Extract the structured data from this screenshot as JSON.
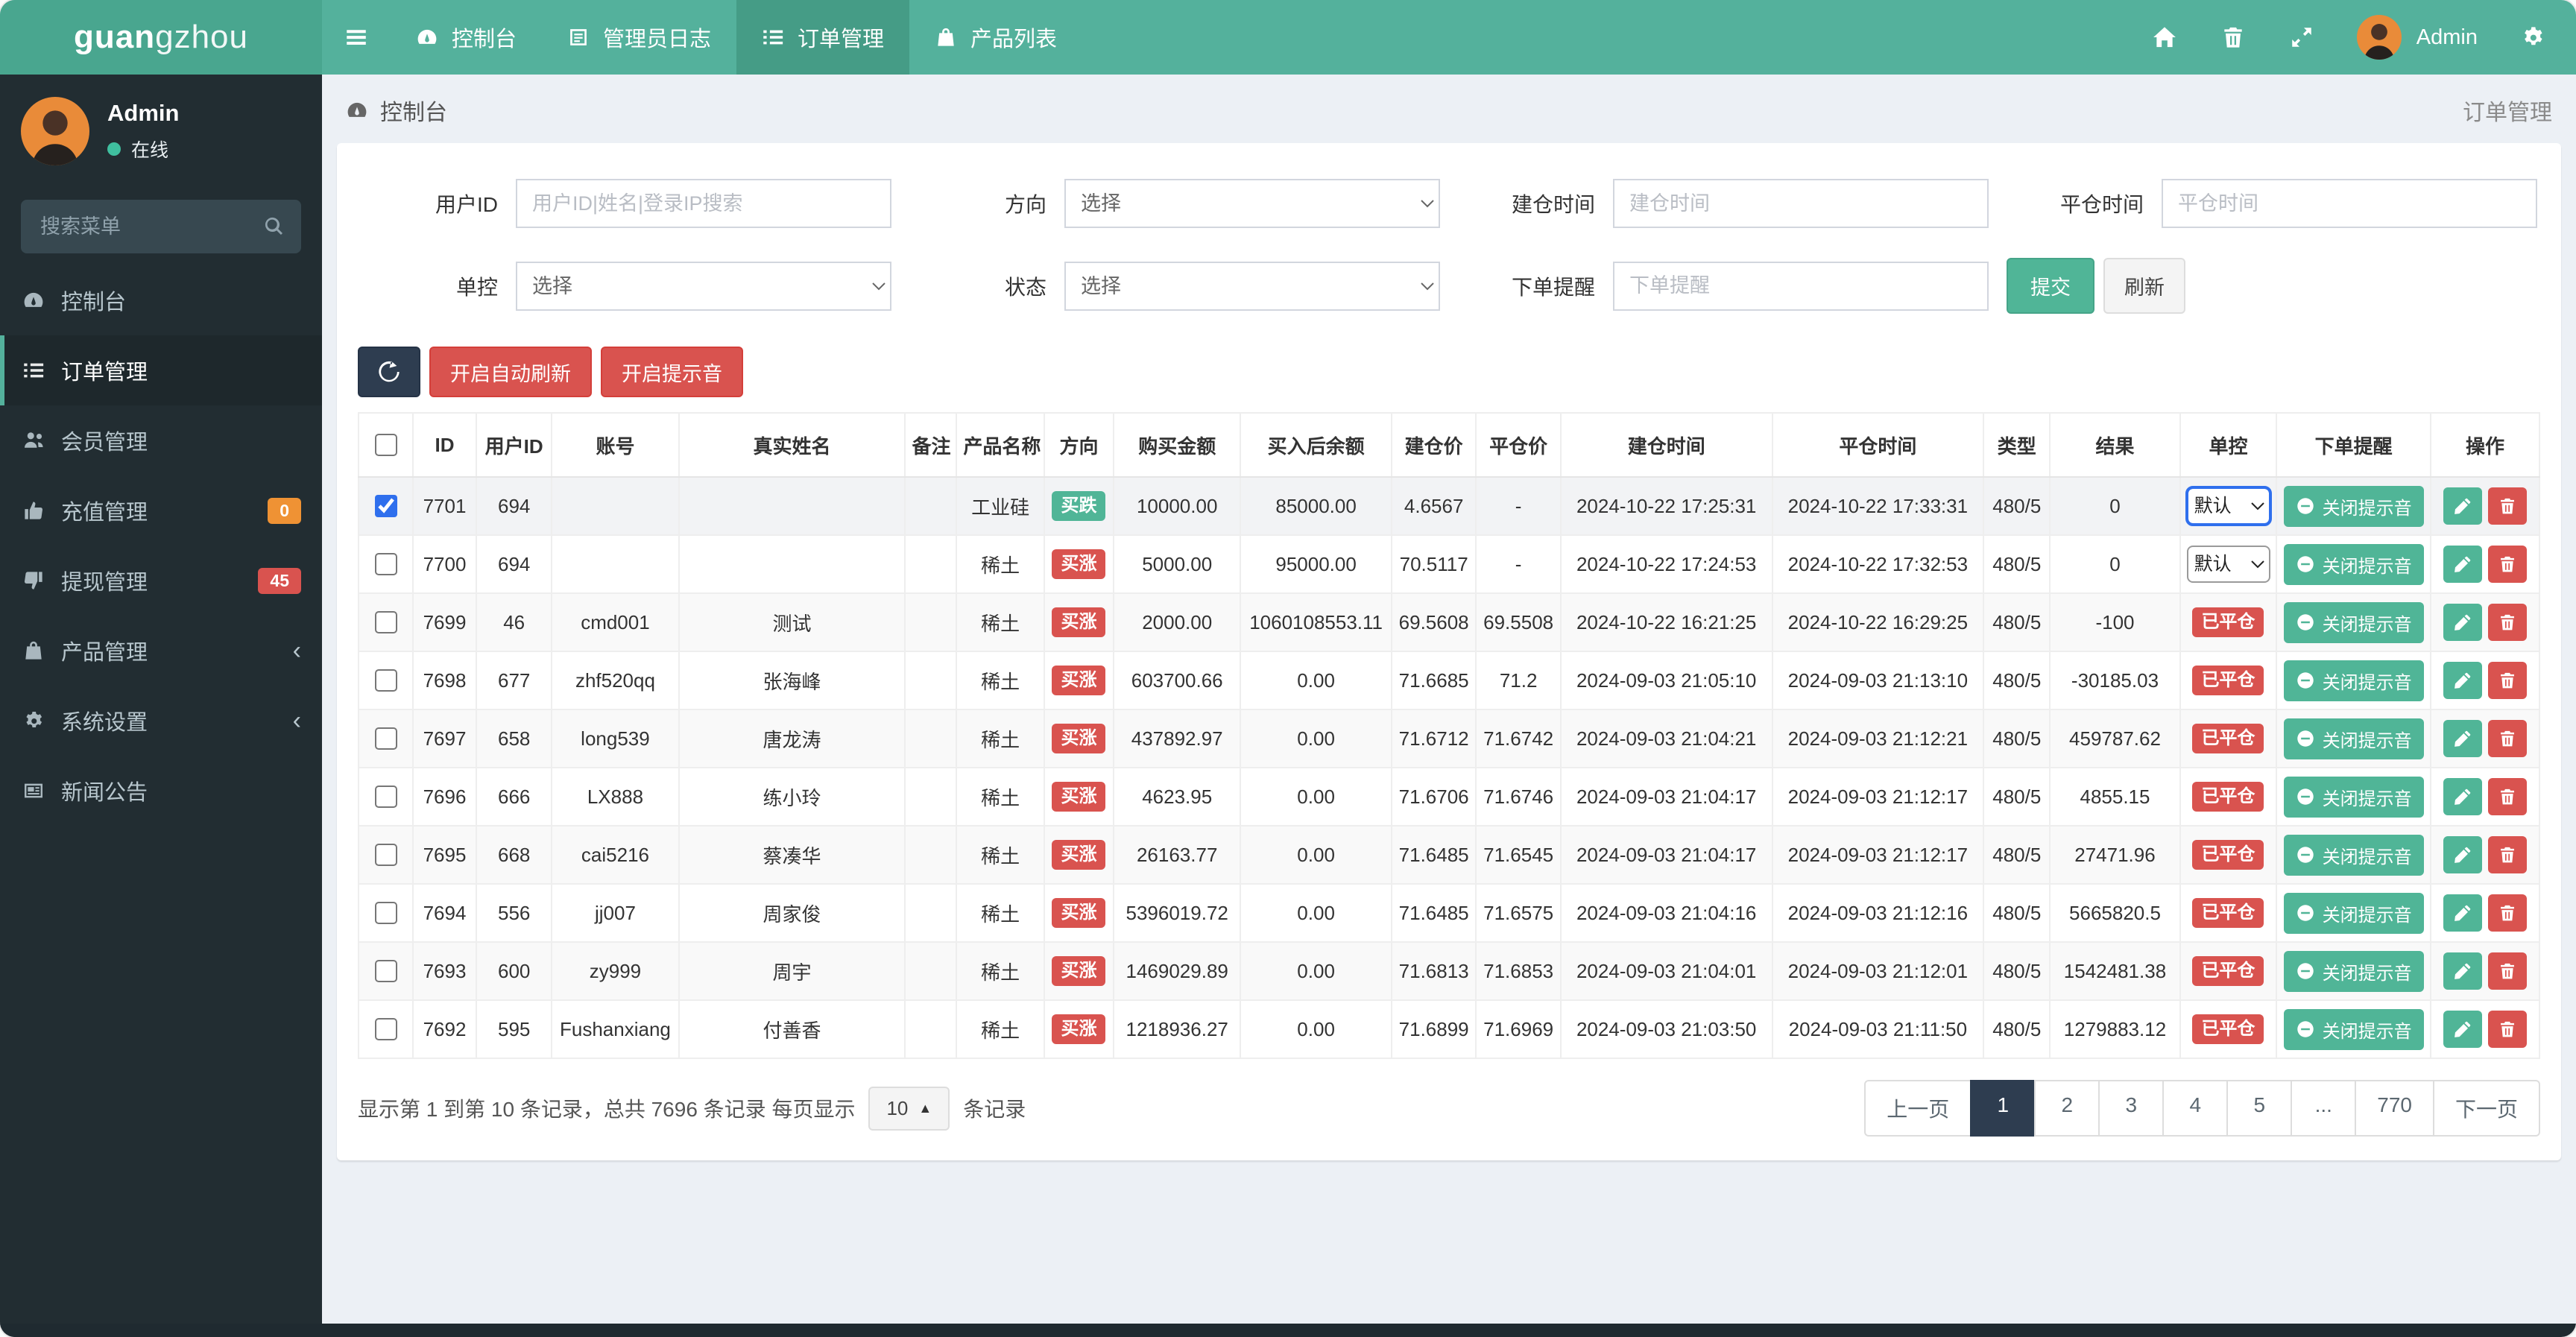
{
  "colors": {
    "navbar": "#54b19c",
    "brand_bg": "#49a68f",
    "sidebar": "#222d32",
    "accent_green": "#50b597",
    "danger_red": "#d9534f",
    "warning_orange": "#ef9234",
    "dark_navy": "#2e3d50",
    "focus_blue": "#2f6fed",
    "content_bg": "#ecf0f5"
  },
  "navbar": {
    "brand_bold": "guan",
    "brand_light": "gzhou",
    "user_name": "Admin",
    "items": [
      {
        "label": "控制台",
        "icon": "dashboard-icon",
        "active": false
      },
      {
        "label": "管理员日志",
        "icon": "log-icon",
        "active": false
      },
      {
        "label": "订单管理",
        "icon": "list-icon",
        "active": true
      },
      {
        "label": "产品列表",
        "icon": "bag-icon",
        "active": false
      }
    ]
  },
  "sidebar": {
    "user": {
      "name": "Admin",
      "status": "在线"
    },
    "search_placeholder": "搜索菜单",
    "items": [
      {
        "label": "控制台",
        "icon": "dashboard-icon"
      },
      {
        "label": "订单管理",
        "icon": "list-icon",
        "active": true
      },
      {
        "label": "会员管理",
        "icon": "users-icon"
      },
      {
        "label": "充值管理",
        "icon": "thumbs-up-icon",
        "badge": "0",
        "badge_color": "#ef9234"
      },
      {
        "label": "提现管理",
        "icon": "thumbs-down-icon",
        "badge": "45",
        "badge_color": "#d9534f"
      },
      {
        "label": "产品管理",
        "icon": "bag-icon",
        "chevron": true
      },
      {
        "label": "系统设置",
        "icon": "gears-icon",
        "chevron": true
      },
      {
        "label": "新闻公告",
        "icon": "news-icon"
      }
    ]
  },
  "breadcrumb": {
    "left": "控制台",
    "right": "订单管理"
  },
  "filters": {
    "user_id": {
      "label": "用户ID",
      "placeholder": "用户ID|姓名|登录IP搜索",
      "value": ""
    },
    "direction": {
      "label": "方向",
      "value": "选择"
    },
    "open_time": {
      "label": "建仓时间",
      "placeholder": "建仓时间",
      "value": ""
    },
    "close_time": {
      "label": "平仓时间",
      "placeholder": "平仓时间",
      "value": ""
    },
    "control": {
      "label": "单控",
      "value": "选择"
    },
    "status": {
      "label": "状态",
      "value": "选择"
    },
    "order_reminder": {
      "label": "下单提醒",
      "placeholder": "下单提醒",
      "value": ""
    },
    "submit_label": "提交",
    "refresh_label": "刷新"
  },
  "toolbar": {
    "auto_refresh_label": "开启自动刷新",
    "sound_label": "开启提示音"
  },
  "table": {
    "headers": [
      "ID",
      "用户ID",
      "账号",
      "真实姓名",
      "备注",
      "产品名称",
      "方向",
      "购买金额",
      "买入后余额",
      "建仓价",
      "平仓价",
      "建仓时间",
      "平仓时间",
      "类型",
      "结果",
      "单控",
      "下单提醒",
      "操作"
    ],
    "close_sound_label": "关闭提示音",
    "control_closed_label": "已平仓",
    "control_default_label": "默认",
    "rows": [
      {
        "checked": true,
        "selected": true,
        "id": "7701",
        "user_id": "694",
        "account": "",
        "real_name": "",
        "remark": "",
        "product": "工业硅",
        "direction": {
          "label": "买跌",
          "kind": "down"
        },
        "amount": "10000.00",
        "balance": "85000.00",
        "open_price": "4.6567",
        "close_price": "-",
        "open_time": "2024-10-22 17:25:31",
        "close_time": "2024-10-22 17:33:31",
        "type": "480/5",
        "result": "0",
        "control": {
          "kind": "select",
          "value": "默认",
          "focused": true
        }
      },
      {
        "checked": false,
        "id": "7700",
        "user_id": "694",
        "account": "",
        "real_name": "",
        "remark": "",
        "product": "稀土",
        "direction": {
          "label": "买涨",
          "kind": "up"
        },
        "amount": "5000.00",
        "balance": "95000.00",
        "open_price": "70.5117",
        "close_price": "-",
        "open_time": "2024-10-22 17:24:53",
        "close_time": "2024-10-22 17:32:53",
        "type": "480/5",
        "result": "0",
        "control": {
          "kind": "select",
          "value": "默认",
          "focused": false
        }
      },
      {
        "checked": false,
        "id": "7699",
        "user_id": "46",
        "account": "cmd001",
        "real_name": "测试",
        "remark": "",
        "product": "稀土",
        "direction": {
          "label": "买涨",
          "kind": "up"
        },
        "amount": "2000.00",
        "balance": "1060108553.11",
        "open_price": "69.5608",
        "close_price": "69.5508",
        "open_time": "2024-10-22 16:21:25",
        "close_time": "2024-10-22 16:29:25",
        "type": "480/5",
        "result": "-100",
        "control": {
          "kind": "badge",
          "value": "已平仓"
        }
      },
      {
        "checked": false,
        "id": "7698",
        "user_id": "677",
        "account": "zhf520qq",
        "real_name": "张海峰",
        "remark": "",
        "product": "稀土",
        "direction": {
          "label": "买涨",
          "kind": "up"
        },
        "amount": "603700.66",
        "balance": "0.00",
        "open_price": "71.6685",
        "close_price": "71.2",
        "open_time": "2024-09-03 21:05:10",
        "close_time": "2024-09-03 21:13:10",
        "type": "480/5",
        "result": "-30185.03",
        "control": {
          "kind": "badge",
          "value": "已平仓"
        }
      },
      {
        "checked": false,
        "id": "7697",
        "user_id": "658",
        "account": "long539",
        "real_name": "唐龙涛",
        "remark": "",
        "product": "稀土",
        "direction": {
          "label": "买涨",
          "kind": "up"
        },
        "amount": "437892.97",
        "balance": "0.00",
        "open_price": "71.6712",
        "close_price": "71.6742",
        "open_time": "2024-09-03 21:04:21",
        "close_time": "2024-09-03 21:12:21",
        "type": "480/5",
        "result": "459787.62",
        "control": {
          "kind": "badge",
          "value": "已平仓"
        }
      },
      {
        "checked": false,
        "id": "7696",
        "user_id": "666",
        "account": "LX888",
        "real_name": "练小玲",
        "remark": "",
        "product": "稀土",
        "direction": {
          "label": "买涨",
          "kind": "up"
        },
        "amount": "4623.95",
        "balance": "0.00",
        "open_price": "71.6706",
        "close_price": "71.6746",
        "open_time": "2024-09-03 21:04:17",
        "close_time": "2024-09-03 21:12:17",
        "type": "480/5",
        "result": "4855.15",
        "control": {
          "kind": "badge",
          "value": "已平仓"
        }
      },
      {
        "checked": false,
        "id": "7695",
        "user_id": "668",
        "account": "cai5216",
        "real_name": "蔡凑华",
        "remark": "",
        "product": "稀土",
        "direction": {
          "label": "买涨",
          "kind": "up"
        },
        "amount": "26163.77",
        "balance": "0.00",
        "open_price": "71.6485",
        "close_price": "71.6545",
        "open_time": "2024-09-03 21:04:17",
        "close_time": "2024-09-03 21:12:17",
        "type": "480/5",
        "result": "27471.96",
        "control": {
          "kind": "badge",
          "value": "已平仓"
        }
      },
      {
        "checked": false,
        "id": "7694",
        "user_id": "556",
        "account": "jj007",
        "real_name": "周家俊",
        "remark": "",
        "product": "稀土",
        "direction": {
          "label": "买涨",
          "kind": "up"
        },
        "amount": "5396019.72",
        "balance": "0.00",
        "open_price": "71.6485",
        "close_price": "71.6575",
        "open_time": "2024-09-03 21:04:16",
        "close_time": "2024-09-03 21:12:16",
        "type": "480/5",
        "result": "5665820.5",
        "control": {
          "kind": "badge",
          "value": "已平仓"
        }
      },
      {
        "checked": false,
        "id": "7693",
        "user_id": "600",
        "account": "zy999",
        "real_name": "周宇",
        "remark": "",
        "product": "稀土",
        "direction": {
          "label": "买涨",
          "kind": "up"
        },
        "amount": "1469029.89",
        "balance": "0.00",
        "open_price": "71.6813",
        "close_price": "71.6853",
        "open_time": "2024-09-03 21:04:01",
        "close_time": "2024-09-03 21:12:01",
        "type": "480/5",
        "result": "1542481.38",
        "control": {
          "kind": "badge",
          "value": "已平仓"
        }
      },
      {
        "checked": false,
        "id": "7692",
        "user_id": "595",
        "account": "Fushanxiang",
        "real_name": "付善香",
        "remark": "",
        "product": "稀土",
        "direction": {
          "label": "买涨",
          "kind": "up"
        },
        "amount": "1218936.27",
        "balance": "0.00",
        "open_price": "71.6899",
        "close_price": "71.6969",
        "open_time": "2024-09-03 21:03:50",
        "close_time": "2024-09-03 21:11:50",
        "type": "480/5",
        "result": "1279883.12",
        "control": {
          "kind": "badge",
          "value": "已平仓"
        }
      }
    ]
  },
  "pagination": {
    "info_prefix": "显示第 1 到第 10 条记录，总共 7696 条记录 每页显示",
    "info_suffix": "条记录",
    "page_size": "10",
    "pages": [
      {
        "label": "上一页",
        "kind": "prev"
      },
      {
        "label": "1",
        "active": true
      },
      {
        "label": "2"
      },
      {
        "label": "3"
      },
      {
        "label": "4"
      },
      {
        "label": "5"
      },
      {
        "label": "...",
        "dots": true
      },
      {
        "label": "770"
      },
      {
        "label": "下一页",
        "kind": "next"
      }
    ]
  }
}
